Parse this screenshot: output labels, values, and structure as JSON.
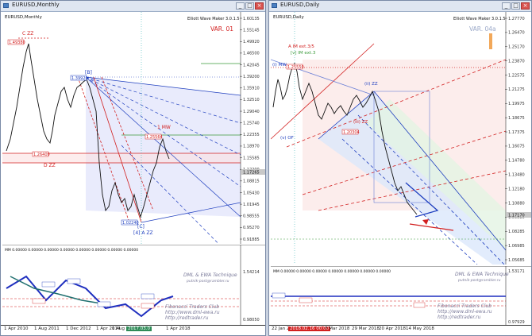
{
  "left_window": {
    "title": "EURUSD,Monthly",
    "symbol_label": "EURUSD,Monthly",
    "header_note": "Elliott Wave Maker 3.0.1.5",
    "variant": "VAR. 01",
    "indicator_label": "MM 0.00000 0.00000 0.00000 0.00000 0.00000 0.00000 0.00000 0.00000",
    "watermark_1": "DML & EWA Technique",
    "watermark_2": "putnik-post@rambler.ru",
    "watermark_3": "Fibonacci    Traders    Club",
    "watermark_4": "http://www.dml-ewa.ru",
    "watermark_5": "http://redtrader.ru",
    "x_ticks": [
      "1 Apr 2010",
      "1 Aug 2011",
      "1 Dec 2012",
      "1 Apr 2014",
      "1 Aug",
      "2017.03.0",
      "1 Apr 2018"
    ],
    "y_ticks": [
      "1.60135",
      "1.55145",
      "1.49920",
      "1.46500",
      "1.42045",
      "1.39200",
      "1.35910",
      "1.32510",
      "1.29040",
      "1.25740",
      "1.22355",
      "1.18970",
      "1.15585",
      "1.12200",
      "1.08815",
      "1.05430",
      "1.01945",
      "0.98555",
      "0.95270",
      "0.91885"
    ],
    "ind_y_ticks": [
      "1.54214",
      "0.98050"
    ],
    "wave_labels": [
      "C ZZ",
      "D ZZ",
      "1 MW",
      "[C]",
      "[4] A ZZ",
      "[B]"
    ],
    "price_tags": [
      "1.49380",
      "1.39920",
      "1.26409",
      "1.25564",
      "1.02240"
    ],
    "current_price": "1.17265"
  },
  "right_window": {
    "title": "EURUSD,Daily",
    "symbol_label": "EURUSD,Daily",
    "header_note": "Elliott Wave Maker 3.0.1.5",
    "variant": "VAR. 04a",
    "indicator_label": "MM 0.00000 0.00000 0.00000 0.00000 0.00000 0.00000 0.00000",
    "watermark_1": "DML & EWA Technique",
    "watermark_2": "putnik-post@rambler.ru",
    "watermark_3": "Fibonacci    Traders    Club",
    "watermark_4": "http://www.dml-ewa.ru",
    "watermark_5": "http://redtrader.ru",
    "wave_labels": [
      "A IM ext.3/5",
      "[v] IM ext.3",
      "(i) MW",
      "(ii) ZZ",
      "(iii) ZZ",
      "(v) OF"
    ],
    "x_ticks": [
      "22 Jan 2018",
      "2018.02.16 00:00",
      "7 Mar 2018",
      "29 Mar 2018",
      "20 Apr 2018",
      "14 May 2018"
    ],
    "y_ticks": [
      "1.27770",
      "1.26470",
      "1.25170",
      "1.23870",
      "1.22575",
      "1.21275",
      "1.19975",
      "1.18675",
      "1.17375",
      "1.16075",
      "1.14780",
      "1.13480",
      "1.12180",
      "1.10880",
      "1.09580",
      "1.08285",
      "1.06985",
      "1.05685"
    ],
    "ind_y_ticks": [
      "1.53171",
      "0.97929"
    ],
    "price_tags": [
      "1.25550",
      "1.20304",
      "1.17170"
    ],
    "current_price": "1.17170"
  },
  "window_buttons": {
    "minimize": "_",
    "maximize": "□",
    "close": "×"
  },
  "colors": {
    "blue": "#1f3fbf",
    "red": "#d21f1f",
    "green": "#3a9a3a",
    "navy": "#0a1a80"
  }
}
